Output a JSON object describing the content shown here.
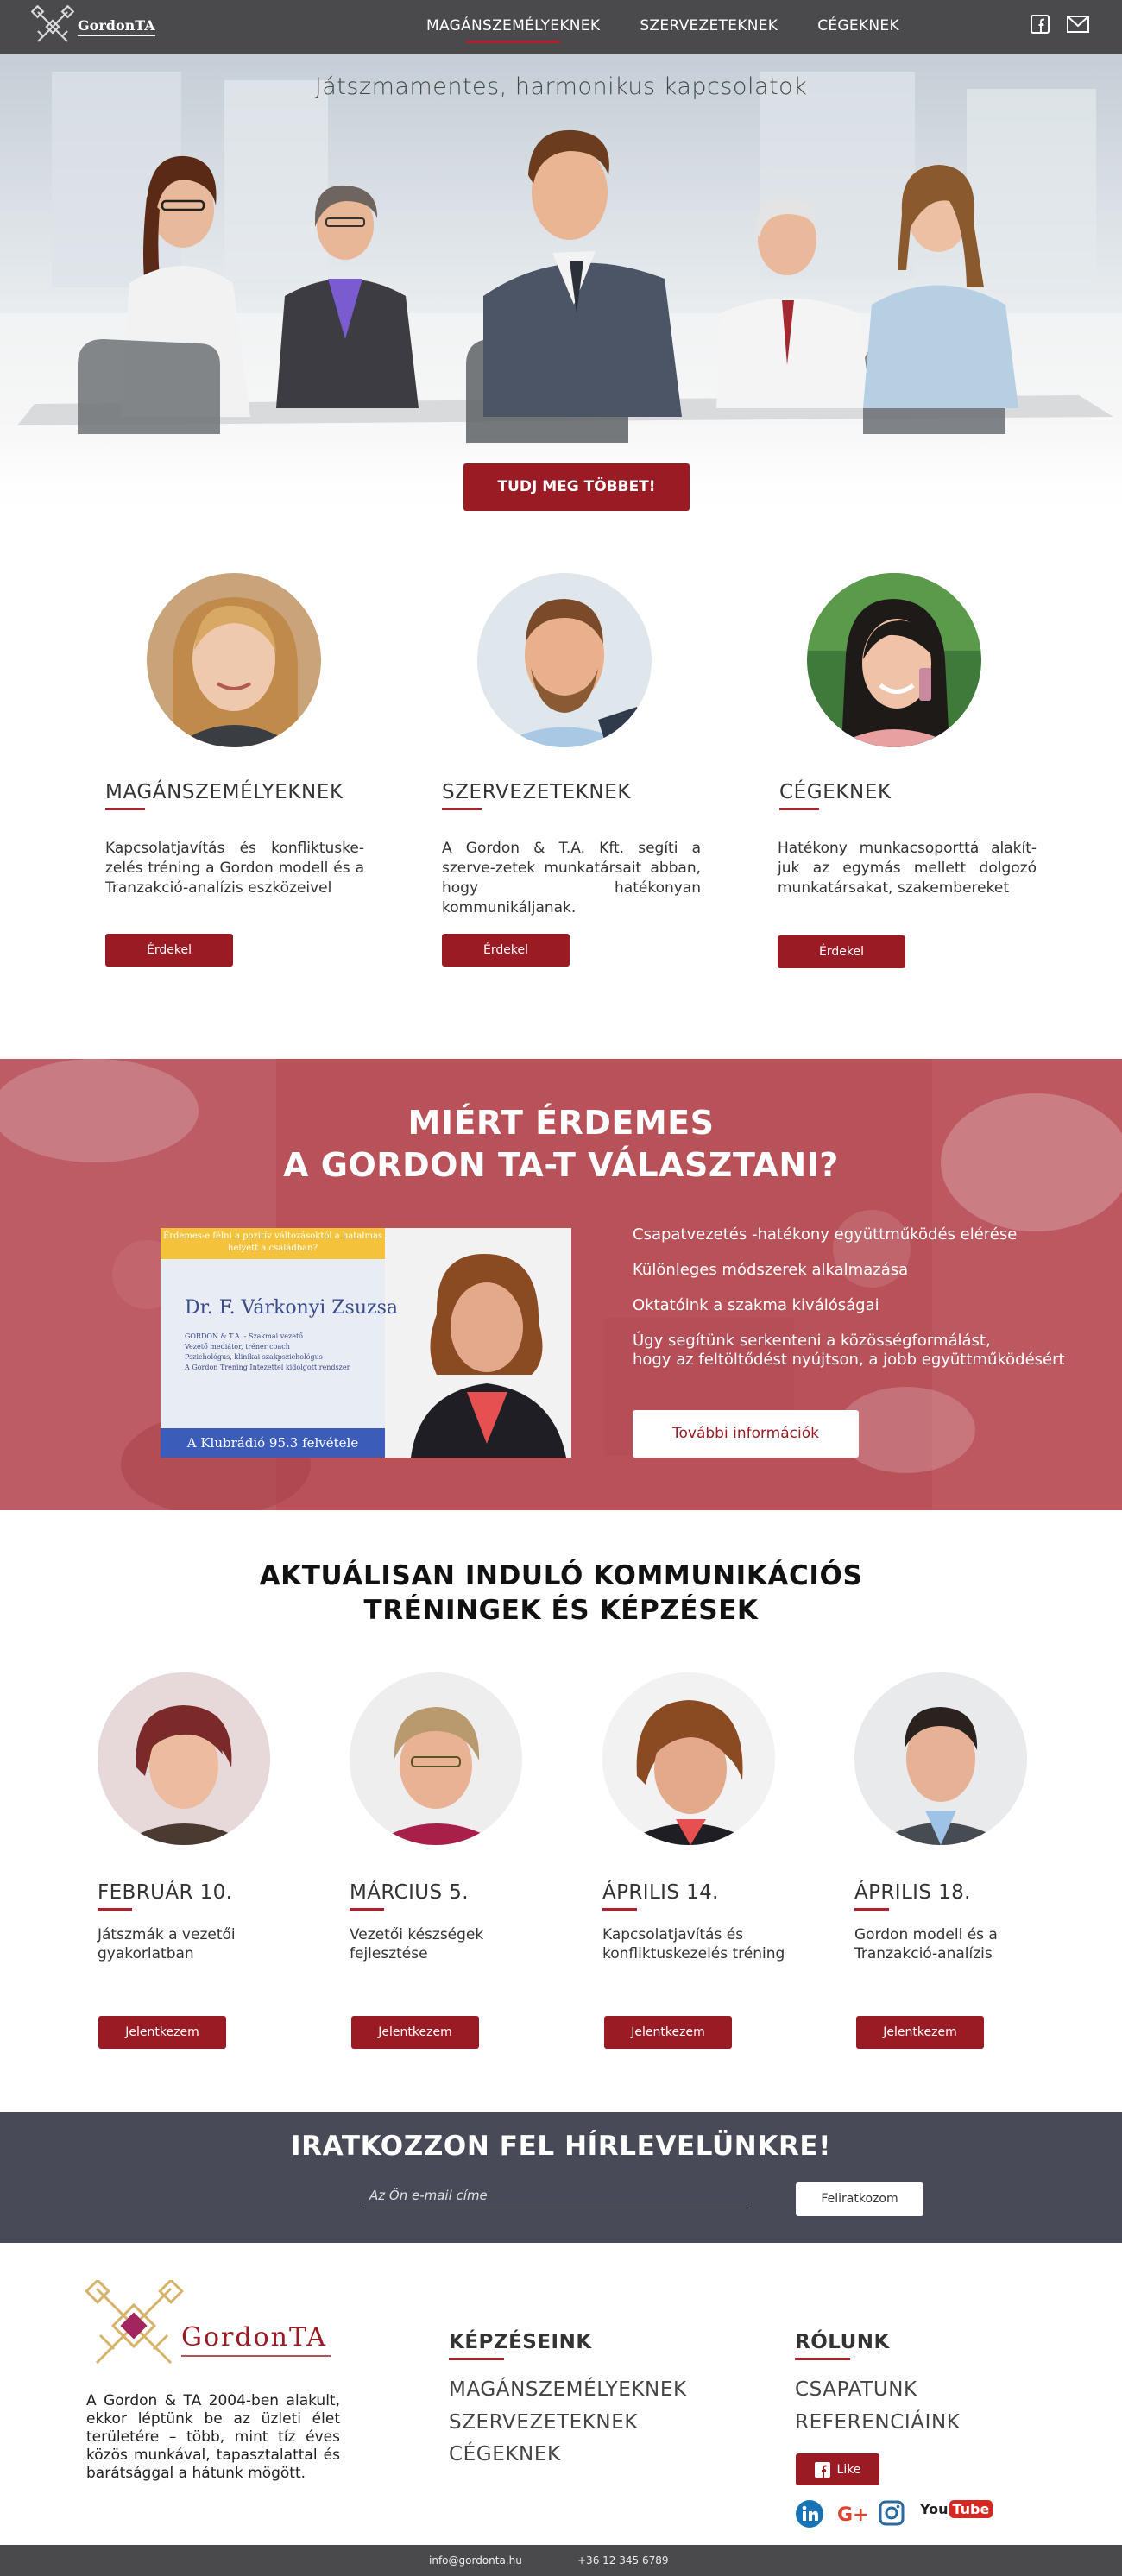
{
  "nav": {
    "logo_text": "GordonTA",
    "links": [
      "MAGÁNSZEMÉLYEKNEK",
      "SZERVEZETEKNEK",
      "CÉGEKNEK"
    ],
    "social_icons": [
      "facebook-icon",
      "mail-icon"
    ]
  },
  "hero": {
    "title": "Játszmamentes, harmonikus kapcsolatok",
    "button": "TUDJ MEG TÖBBET!"
  },
  "services": [
    {
      "title": "MAGÁNSZEMÉLYEKNEK",
      "desc": "Kapcsolatjavítás és konfliktuske-zelés tréning a Gordon modell és a Tranzakció-analízis eszközeivel",
      "button": "Érdekel"
    },
    {
      "title": "SZERVEZETEKNEK",
      "desc": "A Gordon & T.A. Kft. segíti a szerve-zetek munkatársait abban, hogy hatékonyan kommunikáljanak.",
      "button": "Érdekel"
    },
    {
      "title": "CÉGEKNEK",
      "desc": "Hatékony munkacsoporttá alakít-juk az egymás mellett dolgozó munkatársakat, szakembereket",
      "button": "Érdekel"
    }
  ],
  "why": {
    "title_line1": "MIÉRT ÉRDEMES",
    "title_line2": "A GORDON TA-T VÁLASZTANI?",
    "image": {
      "banner": "Érdemes-e félni a pozitív változásoktól a hatalmas helyett a családban?",
      "name": "Dr. F. Várkonyi Zsuzsa",
      "lines": [
        "GORDON & T.A. - Szakmai vezető",
        "Vezető mediátor, tréner coach",
        "Pszichológus, klinikai szakpszichológus",
        "A Gordon Tréning Intézettel kidolgott rendszer"
      ],
      "footer": "A Klubrádió 95.3 felvétele"
    },
    "items": [
      "Csapatvezetés -hatékony együttműködés elérése",
      "Különleges módszerek alkalmazása",
      "Oktatóink a szakma kiválóságai",
      "Úgy segítünk serkenteni a közösségformálást,",
      "hogy az feltöltődést nyújtson, a jobb együttműködésért"
    ],
    "button": "További információk"
  },
  "trainings": {
    "title_line1": "AKTUÁLISAN INDULÓ KOMMUNIKÁCIÓS",
    "title_line2": "TRÉNINGEK ÉS KÉPZÉSEK",
    "items": [
      {
        "date": "FEBRUÁR 10.",
        "desc": "Játszmák a vezetői gyakorlatban",
        "button": "Jelentkezem"
      },
      {
        "date": "MÁRCIUS 5.",
        "desc": "Vezetői készségek fejlesztése",
        "button": "Jelentkezem"
      },
      {
        "date": "ÁPRILIS 14.",
        "desc": "Kapcsolatjavítás és konfliktuskezelés tréning",
        "button": "Jelentkezem"
      },
      {
        "date": "ÁPRILIS 18.",
        "desc": "Gordon modell és a Tranzakció-analízis",
        "button": "Jelentkezem"
      }
    ]
  },
  "newsletter": {
    "title": "IRATKOZZON FEL HÍRLEVELÜNKRE!",
    "placeholder": "Az Ön e-mail címe",
    "button": "Feliratkozom"
  },
  "footer": {
    "logo_text": "GordonTA",
    "about": "A Gordon & TA 2004-ben alakult, ekkor léptünk be az üzleti élet területére – több, mint tíz éves közös munkával, tapasztalattal és barátsággal a hátunk mögött.",
    "trainings_title": "KÉPZÉSEINK",
    "trainings_links": [
      "MAGÁNSZEMÉLYEKNEK",
      "SZERVEZETEKNEK",
      "CÉGEKNEK"
    ],
    "about_title": "RÓLUNK",
    "about_links": [
      "CSAPATUNK",
      "REFERENCIÁINK"
    ],
    "like": "Like",
    "social_icons": [
      "linkedin-icon",
      "google-plus-icon",
      "instagram-icon",
      "youtube-icon"
    ],
    "youtube_text": "You",
    "youtube_text2": "Tube",
    "email": "info@gordonta.hu",
    "phone": "+36 12 345 6789"
  },
  "colors": {
    "brand_red": "#9b1b24",
    "accent_red": "#b31f2c",
    "nav_bg": "#4a4a4c",
    "newsletter_bg": "#484a57"
  }
}
